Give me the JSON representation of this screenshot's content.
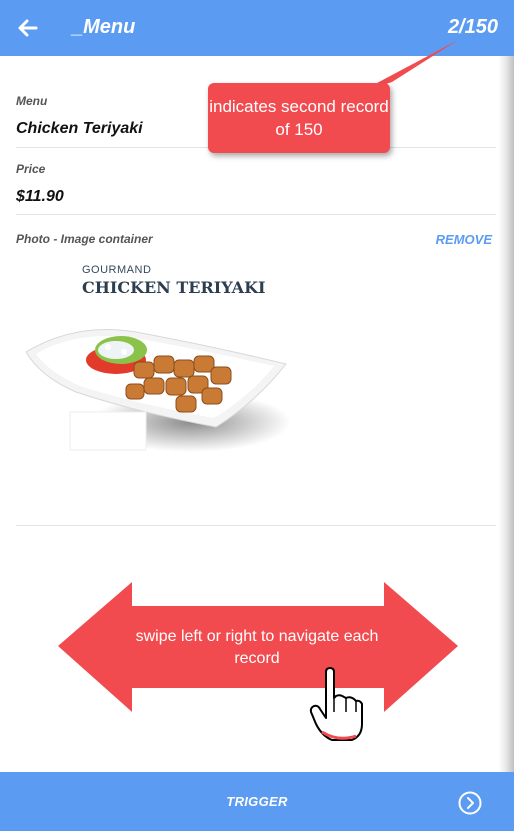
{
  "header": {
    "title": "_Menu",
    "record_counter": "2/150",
    "back_icon": "arrow-left-icon"
  },
  "fields": [
    {
      "label": "Menu",
      "value": "Chicken Teriyaki"
    },
    {
      "label": "Price",
      "value": "$11.90"
    }
  ],
  "photo": {
    "label": "Photo - Image container",
    "remove_label": "REMOVE",
    "image_brand": "GOURMAND",
    "image_title": "CHICKEN TERIYAKI"
  },
  "footer": {
    "trigger_label": "TRIGGER",
    "next_icon": "circle-chevron-right-icon"
  },
  "annotations": {
    "counter_callout": "indicates second record of 150",
    "swipe_hint": "swipe left or right to navigate each record",
    "hand_icon": "pointing-hand-icon"
  },
  "colors": {
    "bar": "#5b9cf2",
    "accent": "#5b9cf2",
    "annotation_red": "#f24b4f"
  }
}
